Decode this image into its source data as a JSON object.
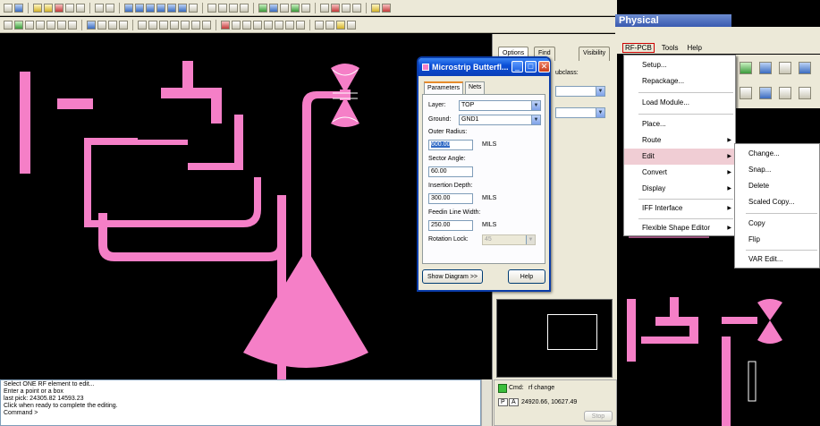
{
  "dialog": {
    "title": "Microstrip Butterfl...",
    "tabs": [
      "Parameters",
      "Nets"
    ],
    "fields": {
      "layer_label": "Layer:",
      "layer_value": "TOP",
      "ground_label": "Ground:",
      "ground_value": "GND1",
      "outer_radius_label": "Outer Radius:",
      "outer_radius_value": "600.00",
      "outer_radius_unit": "MILS",
      "sector_angle_label": "Sector Angle:",
      "sector_angle_value": "60.00",
      "insertion_depth_label": "Insertion Depth:",
      "insertion_depth_value": "300.00",
      "insertion_depth_unit": "MILS",
      "feedin_label": "Feedin Line Width:",
      "feedin_value": "250.00",
      "feedin_unit": "MILS",
      "rotation_label": "Rotation Lock:",
      "rotation_value": "45"
    },
    "show_diagram": "Show Diagram >>",
    "help": "Help"
  },
  "panel": {
    "tabs": [
      "Options",
      "Find",
      "Visibility"
    ],
    "subclass_label": "ubclass:"
  },
  "app_title": "Physical",
  "menubar": [
    "RF-PCB",
    "Tools",
    "Help"
  ],
  "rf_menu": {
    "items": [
      {
        "label": "Setup...",
        "arrow": false
      },
      {
        "label": "Repackage...",
        "arrow": false
      },
      {
        "label": "Load Module...",
        "arrow": false
      },
      {
        "label": "Place...",
        "arrow": false
      },
      {
        "label": "Route",
        "arrow": true
      },
      {
        "label": "Edit",
        "arrow": true
      },
      {
        "label": "Convert",
        "arrow": true
      },
      {
        "label": "Display",
        "arrow": true
      },
      {
        "label": "IFF Interface",
        "arrow": true
      },
      {
        "label": "Flexible Shape Editor",
        "arrow": true
      }
    ]
  },
  "edit_submenu": [
    "Change...",
    "Snap...",
    "Delete",
    "Scaled Copy...",
    "Copy",
    "Flip",
    "VAR Edit..."
  ],
  "command_log": [
    "Select ONE RF element to edit...",
    "Enter a point or a box",
    "last pick:  24305.82 14593.23",
    "Click when ready to complete the editing.",
    "Command >"
  ],
  "status": {
    "cmd_label": "Cmd:",
    "cmd_value": "rf change",
    "p_label": "P",
    "a_label": "A",
    "coords": "24920.66, 10627.49",
    "stop": "Stop"
  },
  "colors": {
    "trace": "#f57fc7",
    "canvas": "#000000",
    "title_bar": "#0b4ed6",
    "menu_highlight": "#f0cdd4"
  }
}
